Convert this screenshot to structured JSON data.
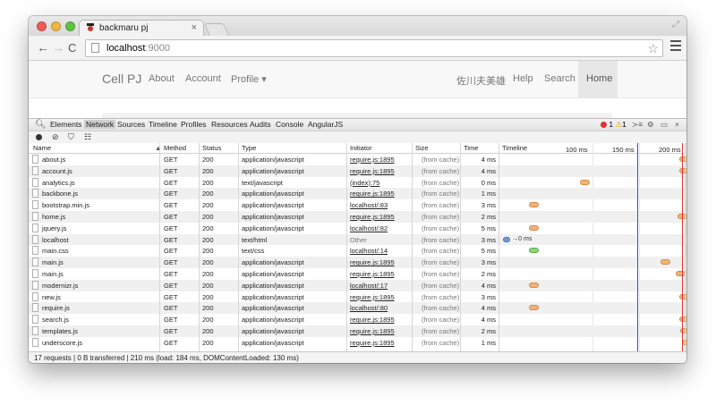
{
  "browser": {
    "tab_title": "backmaru pj",
    "tab_close": "×",
    "url_host": "localhost",
    "url_port": ":9000",
    "nav_back": "←",
    "nav_forward": "→",
    "nav_reload": "C",
    "star": "☆"
  },
  "site": {
    "brand": "Cell PJ",
    "nav_about": "About",
    "nav_account": "Account",
    "nav_profile": "Profile ▾",
    "nav_user": "佐川夫美雄",
    "nav_help": "Help",
    "nav_search": "Search",
    "nav_home": "Home"
  },
  "devtools": {
    "tabs": [
      "Elements",
      "Network",
      "Sources",
      "Timeline",
      "Profiles",
      "Resources",
      "Audits",
      "Console",
      "AngularJS"
    ],
    "selected_tab": "Network",
    "error_count": "1",
    "warning_count": "1",
    "close": "×",
    "columns": {
      "name": "Name",
      "method": "Method",
      "status": "Status",
      "type": "Type",
      "initiator": "Initiator",
      "size": "Size",
      "time": "Time",
      "timeline": "Timeline",
      "sort_arrow": "▲"
    },
    "ticks": [
      "100 ms",
      "150 ms",
      "200 ms"
    ],
    "rows": [
      {
        "name": "about.js",
        "method": "GET",
        "status": "200",
        "type": "application/javascript",
        "initiator": "require.js:1895",
        "size": "(from cache)",
        "time": "4 ms",
        "bar_ms": 193,
        "kind": "cached"
      },
      {
        "name": "account.js",
        "method": "GET",
        "status": "200",
        "type": "application/javascript",
        "initiator": "require.js:1895",
        "size": "(from cache)",
        "time": "4 ms",
        "bar_ms": 193,
        "kind": "cached"
      },
      {
        "name": "analytics.js",
        "method": "GET",
        "status": "200",
        "type": "text/javascript",
        "initiator": "(index):75",
        "size": "(from cache)",
        "time": "0 ms",
        "bar_ms": 87,
        "kind": "cached"
      },
      {
        "name": "backbone.js",
        "method": "GET",
        "status": "200",
        "type": "application/javascript",
        "initiator": "require.js:1895",
        "size": "(from cache)",
        "time": "1 ms",
        "bar_ms": 208,
        "kind": "cached"
      },
      {
        "name": "bootstrap.min.js",
        "method": "GET",
        "status": "200",
        "type": "application/javascript",
        "initiator": "localhost/:83",
        "size": "(from cache)",
        "time": "3 ms",
        "bar_ms": 32,
        "kind": "cached"
      },
      {
        "name": "home.js",
        "method": "GET",
        "status": "200",
        "type": "application/javascript",
        "initiator": "require.js:1895",
        "size": "(from cache)",
        "time": "2 ms",
        "bar_ms": 191,
        "kind": "cached"
      },
      {
        "name": "jquery.js",
        "method": "GET",
        "status": "200",
        "type": "application/javascript",
        "initiator": "localhost/:82",
        "size": "(from cache)",
        "time": "5 ms",
        "bar_ms": 32,
        "kind": "cached"
      },
      {
        "name": "localhost",
        "method": "GET",
        "status": "200",
        "type": "text/html",
        "initiator": "Other",
        "size": "(from cache)",
        "time": "3 ms",
        "bar_ms": 4,
        "kind": "doc",
        "bar_label": "0 ms"
      },
      {
        "name": "main.css",
        "method": "GET",
        "status": "200",
        "type": "text/css",
        "initiator": "localhost/:14",
        "size": "(from cache)",
        "time": "5 ms",
        "bar_ms": 32,
        "kind": "css"
      },
      {
        "name": "main.js",
        "method": "GET",
        "status": "200",
        "type": "application/javascript",
        "initiator": "require.js:1895",
        "size": "(from cache)",
        "time": "3 ms",
        "bar_ms": 173,
        "kind": "cached"
      },
      {
        "name": "main.js",
        "method": "GET",
        "status": "200",
        "type": "application/javascript",
        "initiator": "require.js:1895",
        "size": "(from cache)",
        "time": "2 ms",
        "bar_ms": 189,
        "kind": "cached"
      },
      {
        "name": "modernizr.js",
        "method": "GET",
        "status": "200",
        "type": "application/javascript",
        "initiator": "localhost/:17",
        "size": "(from cache)",
        "time": "4 ms",
        "bar_ms": 32,
        "kind": "cached"
      },
      {
        "name": "new.js",
        "method": "GET",
        "status": "200",
        "type": "application/javascript",
        "initiator": "require.js:1895",
        "size": "(from cache)",
        "time": "3 ms",
        "bar_ms": 193,
        "kind": "cached"
      },
      {
        "name": "require.js",
        "method": "GET",
        "status": "200",
        "type": "application/javascript",
        "initiator": "localhost/:80",
        "size": "(from cache)",
        "time": "4 ms",
        "bar_ms": 32,
        "kind": "cached"
      },
      {
        "name": "search.js",
        "method": "GET",
        "status": "200",
        "type": "application/javascript",
        "initiator": "require.js:1895",
        "size": "(from cache)",
        "time": "4 ms",
        "bar_ms": 193,
        "kind": "cached"
      },
      {
        "name": "templates.js",
        "method": "GET",
        "status": "200",
        "type": "application/javascript",
        "initiator": "require.js:1895",
        "size": "(from cache)",
        "time": "2 ms",
        "bar_ms": 194,
        "kind": "cached"
      },
      {
        "name": "underscore.js",
        "method": "GET",
        "status": "200",
        "type": "application/javascript",
        "initiator": "require.js:1895",
        "size": "(from cache)",
        "time": "1 ms",
        "bar_ms": 196,
        "kind": "cached"
      }
    ],
    "dom_content_loaded_ms": 130,
    "load_ms": 184,
    "status_text": "17 requests | 0 B transferred | 210 ms (load: 184 ms, DOMContentLoaded: 130 ms)"
  }
}
